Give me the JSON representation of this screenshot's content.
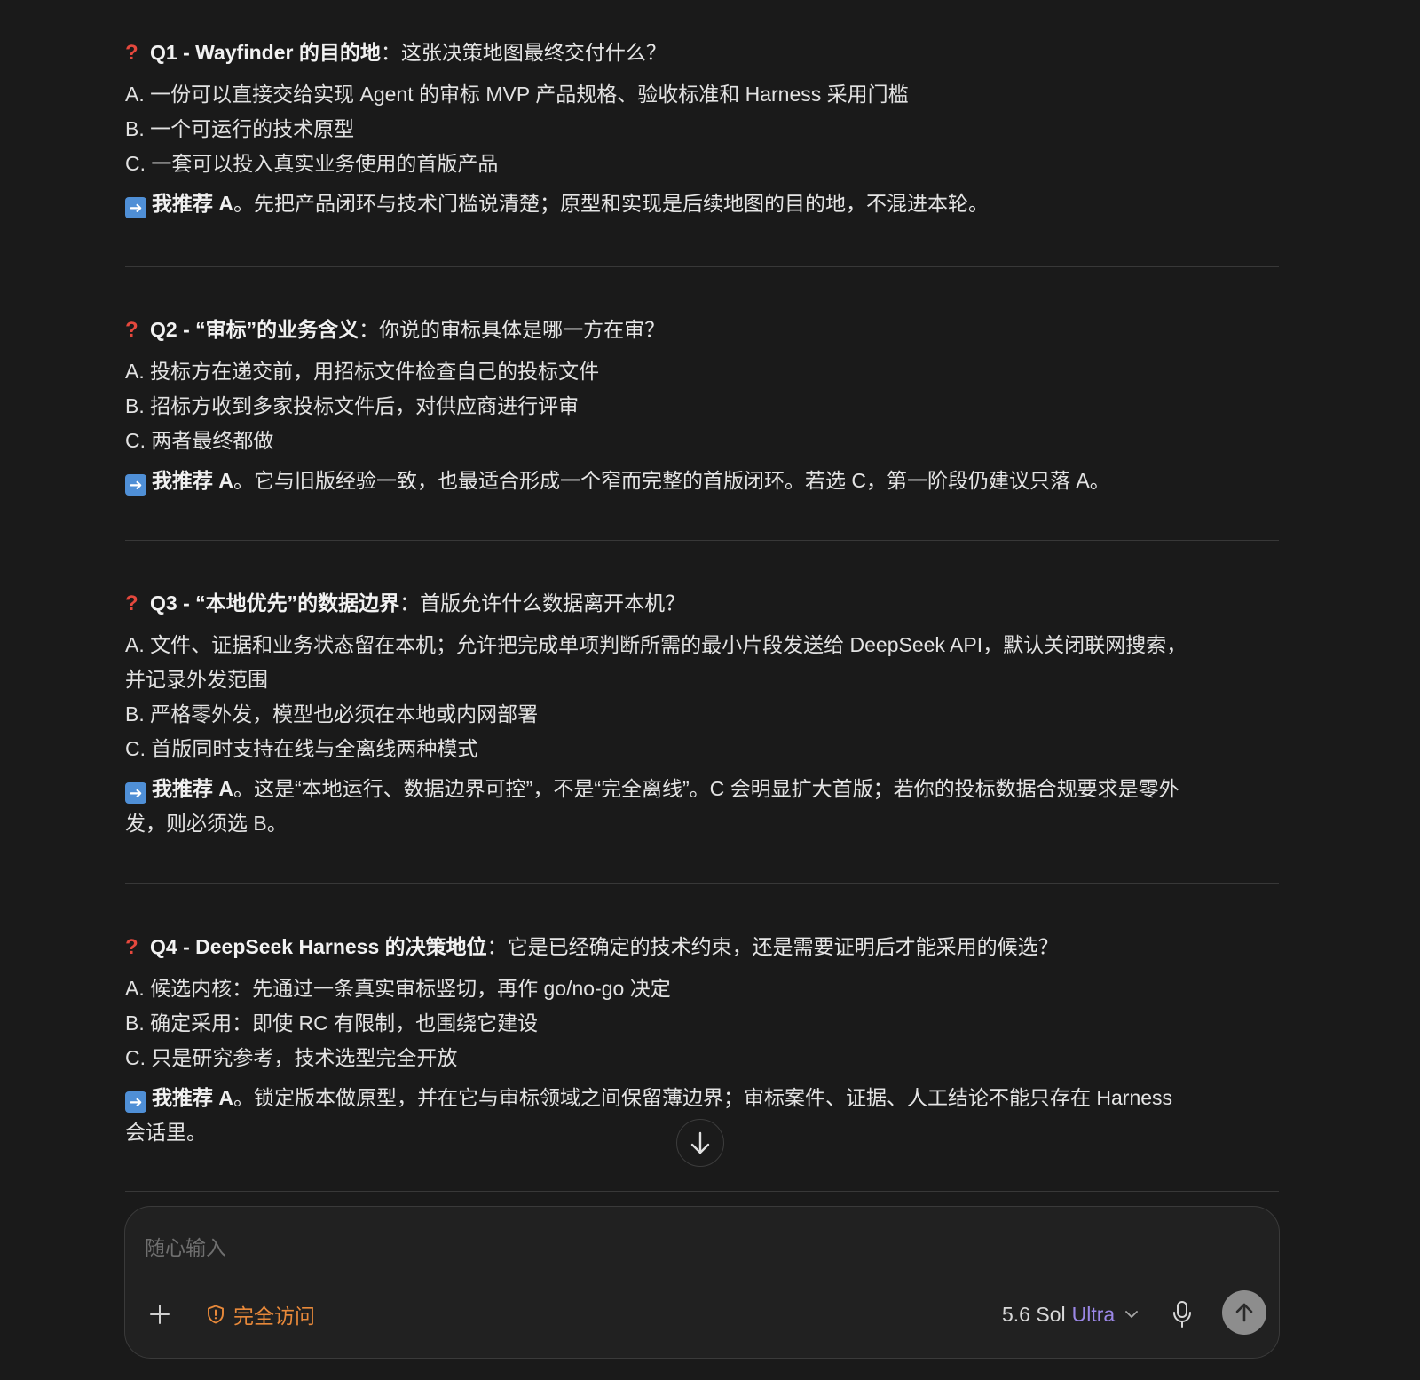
{
  "questions": [
    {
      "title": "Q1 - Wayfinder 的目的地",
      "prompt": "：这张决策地图最终交付什么？",
      "options": [
        "A. 一份可以直接交给实现 Agent 的审标 MVP 产品规格、验收标准和 Harness 采用门槛",
        "B. 一个可运行的技术原型",
        "C. 一套可以投入真实业务使用的首版产品"
      ],
      "rec_label": "我推荐 A",
      "rec_text": "。先把产品闭环与技术门槛说清楚；原型和实现是后续地图的目的地，不混进本轮。"
    },
    {
      "title": "Q2 - “审标”的业务含义",
      "prompt": "：你说的审标具体是哪一方在审？",
      "options": [
        "A. 投标方在递交前，用招标文件检查自己的投标文件",
        "B. 招标方收到多家投标文件后，对供应商进行评审",
        "C. 两者最终都做"
      ],
      "rec_label": "我推荐 A",
      "rec_text": "。它与旧版经验一致，也最适合形成一个窄而完整的首版闭环。若选 C，第一阶段仍建议只落 A。"
    },
    {
      "title": "Q3 - “本地优先”的数据边界",
      "prompt": "：首版允许什么数据离开本机？",
      "options": [
        "A. 文件、证据和业务状态留在本机；允许把完成单项判断所需的最小片段发送给 DeepSeek API，默认关闭联网搜索，",
        "并记录外发范围",
        "B. 严格零外发，模型也必须在本地或内网部署",
        "C. 首版同时支持在线与全离线两种模式"
      ],
      "rec_label": "我推荐 A",
      "rec_text": "。这是“本地运行、数据边界可控”，不是“完全离线”。C 会明显扩大首版；若你的投标数据合规要求是零外",
      "rec_text_2": "发，则必须选 B。"
    },
    {
      "title": "Q4 - DeepSeek Harness 的决策地位",
      "prompt": "：它是已经确定的技术约束，还是需要证明后才能采用的候选？",
      "options": [
        "A. 候选内核：先通过一条真实审标竖切，再作 go/no-go 决定",
        "B. 确定采用：即使 RC 有限制，也围绕它建设",
        "C. 只是研究参考，技术选型完全开放"
      ],
      "rec_label": "我推荐 A",
      "rec_text": "。锁定版本做原型，并在它与审标领域之间保留薄边界；审标案件、证据、人工结论不能只存在 Harness",
      "rec_text_2": "会话里。"
    }
  ],
  "composer": {
    "placeholder": "随心输入",
    "access_label": "完全访问",
    "model_name": "5.6 Sol",
    "model_tier": "Ultra"
  },
  "icons": {
    "question": "question-mark-icon",
    "recommend": "right-arrow-icon",
    "scroll": "arrow-down-icon",
    "plus": "plus-icon",
    "access": "warning-shield-icon",
    "chevron": "chevron-down-icon",
    "mic": "microphone-icon",
    "send": "arrow-up-icon"
  },
  "colors": {
    "background": "#1a1a1a",
    "question_mark": "#e5483d",
    "access_accent": "#e8893a",
    "model_tier": "#9b87e6",
    "send_button": "#8d8d8d"
  }
}
